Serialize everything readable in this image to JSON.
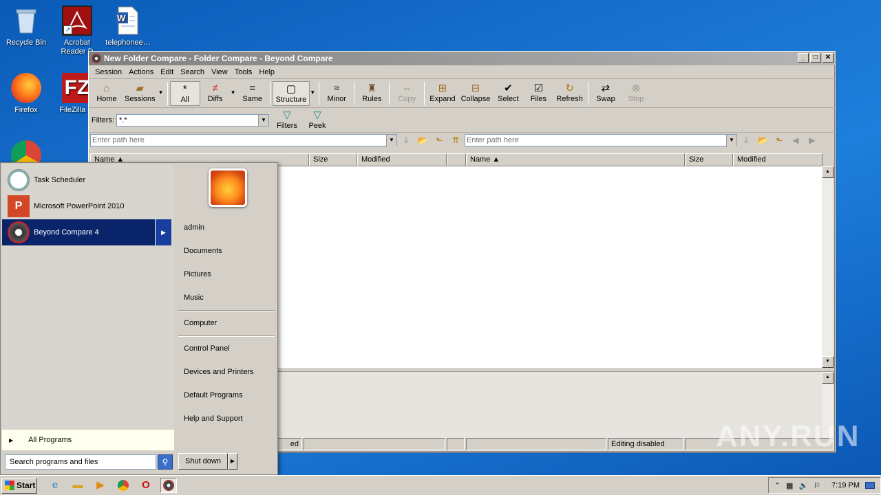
{
  "desktop": {
    "icons": [
      {
        "label": "Recycle Bin"
      },
      {
        "label": "Acrobat Reader D"
      },
      {
        "label": "telephonee…"
      },
      {
        "label": "Firefox"
      },
      {
        "label": "FileZilla Cl"
      }
    ]
  },
  "window": {
    "title": "New Folder Compare - Folder Compare - Beyond Compare",
    "controls": {
      "minimize": "_",
      "maximize": "□",
      "close": "✕"
    }
  },
  "menu": [
    "Session",
    "Actions",
    "Edit",
    "Search",
    "View",
    "Tools",
    "Help"
  ],
  "toolbar": {
    "home": "Home",
    "sessions": "Sessions",
    "all": "All",
    "diffs": "Diffs",
    "same": "Same",
    "structure": "Structure",
    "minor": "Minor",
    "rules": "Rules",
    "copy": "Copy",
    "expand": "Expand",
    "collapse": "Collapse",
    "select": "Select",
    "files": "Files",
    "refresh": "Refresh",
    "swap": "Swap",
    "stop": "Stop"
  },
  "filters": {
    "label": "Filters:",
    "value": "*.*",
    "filters_btn": "Filters",
    "peek_btn": "Peek"
  },
  "paths": {
    "left_placeholder": "Enter path here",
    "right_placeholder": "Enter path here"
  },
  "columns": {
    "left": [
      "Name",
      "Size",
      "Modified"
    ],
    "right": [
      "Name",
      "Size",
      "Modified"
    ]
  },
  "status": {
    "left_partial": "ed",
    "right": "Editing disabled"
  },
  "startmenu": {
    "programs": [
      "Task Scheduler",
      "Microsoft PowerPoint 2010",
      "Beyond Compare 4"
    ],
    "all_programs": "All Programs",
    "search_placeholder": "Search programs and files",
    "right_links": [
      "admin",
      "Documents",
      "Pictures",
      "Music",
      "Computer",
      "Control Panel",
      "Devices and Printers",
      "Default Programs",
      "Help and Support"
    ],
    "shutdown": "Shut down"
  },
  "taskbar": {
    "start": "Start",
    "clock": "7:19 PM"
  },
  "watermark": "ANY.RUN"
}
